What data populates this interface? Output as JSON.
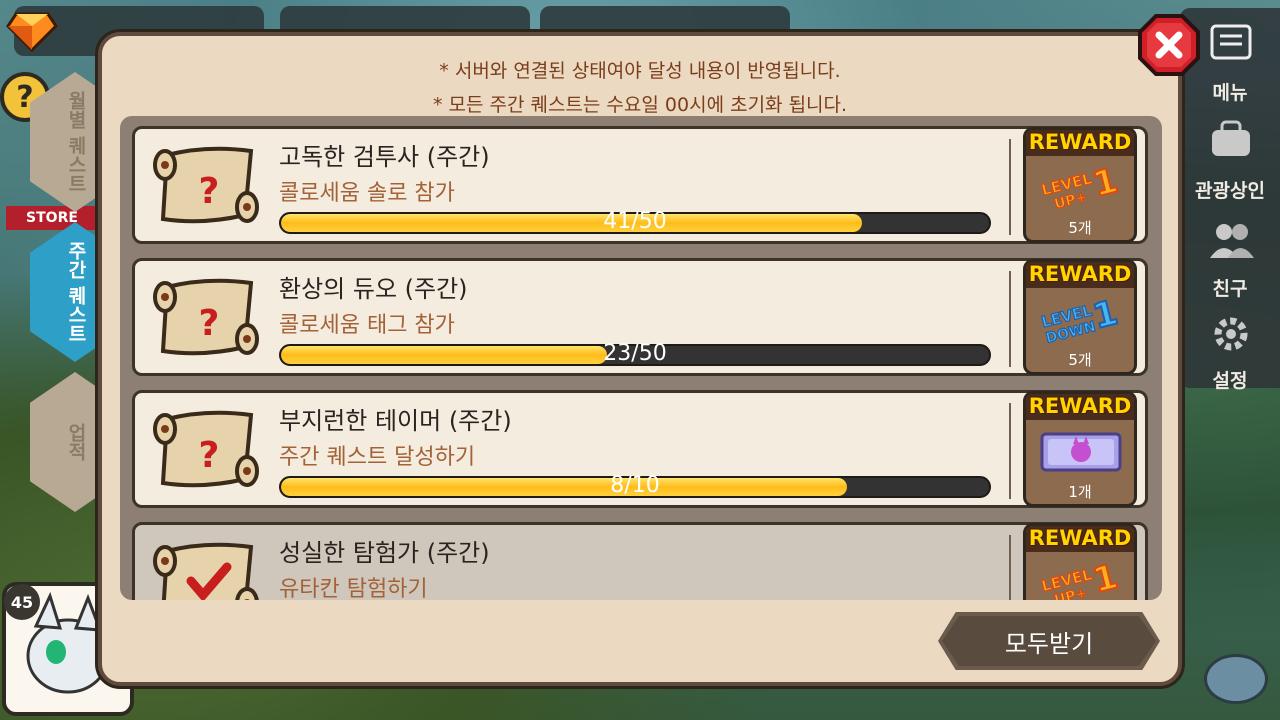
{
  "colors": {
    "accent": "#2e9fc7",
    "notice": "#7a3e1b",
    "desc": "#a46238",
    "bar_fill": "#ffbc1a",
    "reward_label": "#ffd400"
  },
  "hud": {
    "store_label": "STORE",
    "help_label": "?",
    "level": "45"
  },
  "right_menu": [
    {
      "label": "메뉴",
      "icon": "menu-icon"
    },
    {
      "label": "관광상인",
      "icon": "bag-icon"
    },
    {
      "label": "친구",
      "icon": "friends-icon"
    },
    {
      "label": "설정",
      "icon": "gear-icon"
    }
  ],
  "side_tabs": [
    {
      "label": "월별 퀘스트",
      "active": false
    },
    {
      "label": "주간 퀘스트",
      "active": true
    },
    {
      "label": "업적",
      "active": false
    }
  ],
  "notices": [
    "* 서버와 연결된 상태여야 달성 내용이 반영됩니다.",
    "* 모든 주간 퀘스트는 수요일 00시에 초기화 됩니다."
  ],
  "quests": [
    {
      "title": "고독한 검투사 (주간)",
      "desc": "콜로세움 솔로 참가",
      "progress_text": "41/50",
      "progress": 0.82,
      "reward_label": "REWARD",
      "reward_item": "level-up-ticket",
      "reward_text_a": "LEVEL",
      "reward_text_b": "UP+",
      "reward_num": "1",
      "reward_count": "5개",
      "completed": false
    },
    {
      "title": "환상의 듀오 (주간)",
      "desc": "콜로세움 태그 참가",
      "progress_text": "23/50",
      "progress": 0.46,
      "reward_label": "REWARD",
      "reward_item": "level-down-ticket",
      "reward_text_a": "LEVEL",
      "reward_text_b": "DOWN",
      "reward_num": "1",
      "reward_count": "5개",
      "completed": false
    },
    {
      "title": "부지런한 테이머 (주간)",
      "desc": "주간 퀘스트 달성하기",
      "progress_text": "8/10",
      "progress": 0.8,
      "reward_label": "REWARD",
      "reward_item": "summon-ticket",
      "reward_count": "1개",
      "completed": false
    },
    {
      "title": "성실한 탐험가 (주간)",
      "desc": "유타칸 탐험하기",
      "reward_label": "REWARD",
      "reward_item": "level-up-ticket",
      "reward_text_a": "LEVEL",
      "reward_text_b": "UP+",
      "reward_num": "1",
      "completed": true
    }
  ],
  "buttons": {
    "claim_all": "모두받기",
    "close": "close"
  }
}
